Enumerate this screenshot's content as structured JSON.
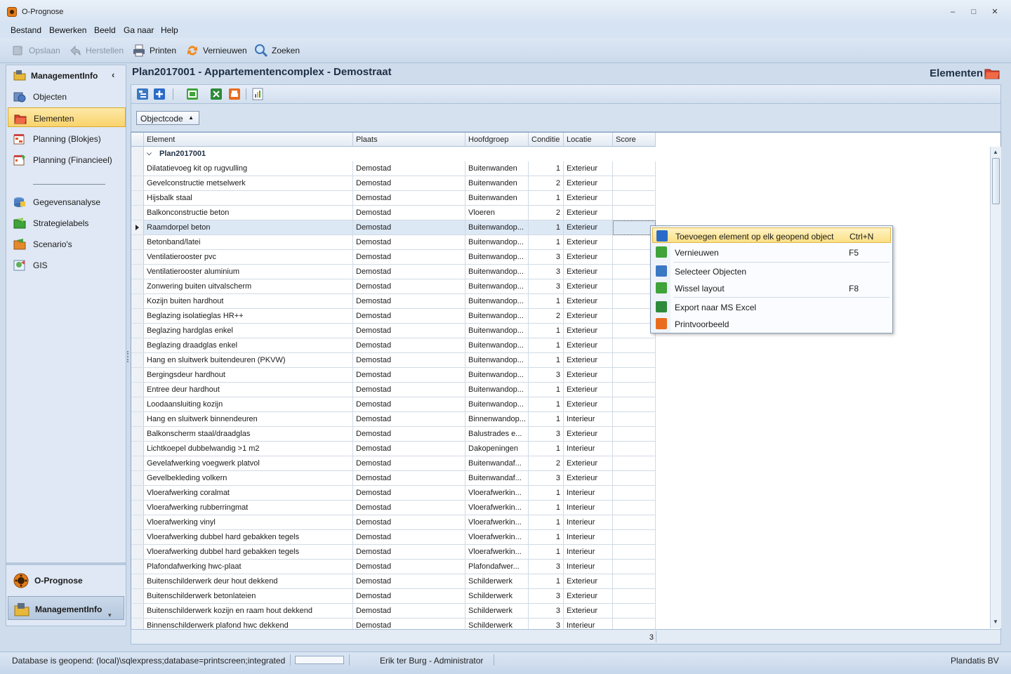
{
  "window": {
    "title": "O-Prognose",
    "minimize": "–",
    "maximize": "□",
    "close": "✕"
  },
  "menu": [
    "Bestand",
    "Bewerken",
    "Beeld",
    "Ga naar",
    "Help"
  ],
  "toolbar": {
    "save": "Opslaan",
    "restore": "Herstellen",
    "print": "Printen",
    "refresh": "Vernieuwen",
    "search": "Zoeken"
  },
  "nav": {
    "header": "ManagementInfo",
    "collapse": "‹",
    "items": [
      {
        "label": "Objecten",
        "icon": "objects-icon"
      },
      {
        "label": "Elementen",
        "icon": "elements-icon",
        "selected": true
      },
      {
        "label": "Planning (Blokjes)",
        "icon": "planning-blocks-icon"
      },
      {
        "label": "Planning (Financieel)",
        "icon": "planning-financial-icon"
      },
      {
        "label": "Gegevensanalyse",
        "icon": "data-analysis-icon"
      },
      {
        "label": "Strategielabels",
        "icon": "strategy-labels-icon"
      },
      {
        "label": "Scenario's",
        "icon": "scenarios-icon"
      },
      {
        "label": "GIS",
        "icon": "gis-icon"
      }
    ],
    "bottom": [
      {
        "label": "O-Prognose",
        "icon": "o-prognose-icon"
      },
      {
        "label": "ManagementInfo",
        "icon": "management-info-icon"
      }
    ],
    "more": "▾"
  },
  "panel": {
    "title": "Plan2017001 - Appartementencomplex - Demostraat",
    "module": "Elementen"
  },
  "groupbar": {
    "chip": "Objectcode",
    "arrow": "▲"
  },
  "grid": {
    "columns": [
      "Element",
      "Plaats",
      "Hoofdgroep",
      "Conditie",
      "Locatie",
      "Score"
    ],
    "group": "Plan2017001",
    "group_toggle": "⌵",
    "rows": [
      [
        "Dilatatievoeg kit op rugvulling",
        "Demostad",
        "Buitenwanden",
        "1",
        "Exterieur",
        ""
      ],
      [
        "Gevelconstructie metselwerk",
        "Demostad",
        "Buitenwanden",
        "2",
        "Exterieur",
        ""
      ],
      [
        "Hijsbalk staal",
        "Demostad",
        "Buitenwanden",
        "1",
        "Exterieur",
        ""
      ],
      [
        "Balkonconstructie beton",
        "Demostad",
        "Vloeren",
        "2",
        "Exterieur",
        ""
      ],
      [
        "Raamdorpel beton",
        "Demostad",
        "Buitenwandop...",
        "1",
        "Exterieur",
        ""
      ],
      [
        "Betonband/latei",
        "Demostad",
        "Buitenwandop...",
        "1",
        "Exterieur",
        ""
      ],
      [
        "Ventilatierooster pvc",
        "Demostad",
        "Buitenwandop...",
        "3",
        "Exterieur",
        ""
      ],
      [
        "Ventilatierooster aluminium",
        "Demostad",
        "Buitenwandop...",
        "3",
        "Exterieur",
        ""
      ],
      [
        "Zonwering buiten uitvalscherm",
        "Demostad",
        "Buitenwandop...",
        "3",
        "Exterieur",
        ""
      ],
      [
        "Kozijn buiten hardhout",
        "Demostad",
        "Buitenwandop...",
        "1",
        "Exterieur",
        ""
      ],
      [
        "Beglazing isolatieglas HR++",
        "Demostad",
        "Buitenwandop...",
        "2",
        "Exterieur",
        ""
      ],
      [
        "Beglazing hardglas enkel",
        "Demostad",
        "Buitenwandop...",
        "1",
        "Exterieur",
        ""
      ],
      [
        "Beglazing draadglas enkel",
        "Demostad",
        "Buitenwandop...",
        "1",
        "Exterieur",
        ""
      ],
      [
        "Hang en sluitwerk buitendeuren (PKVW)",
        "Demostad",
        "Buitenwandop...",
        "1",
        "Exterieur",
        ""
      ],
      [
        "Bergingsdeur hardhout",
        "Demostad",
        "Buitenwandop...",
        "3",
        "Exterieur",
        ""
      ],
      [
        "Entree deur hardhout",
        "Demostad",
        "Buitenwandop...",
        "1",
        "Exterieur",
        ""
      ],
      [
        "Loodaansluiting kozijn",
        "Demostad",
        "Buitenwandop...",
        "1",
        "Exterieur",
        ""
      ],
      [
        "Hang en sluitwerk binnendeuren",
        "Demostad",
        "Binnenwandop...",
        "1",
        "Interieur",
        ""
      ],
      [
        "Balkonscherm staal/draadglas",
        "Demostad",
        "Balustrades e...",
        "3",
        "Exterieur",
        ""
      ],
      [
        "Lichtkoepel dubbelwandig >1 m2",
        "Demostad",
        "Dakopeningen",
        "1",
        "Interieur",
        ""
      ],
      [
        "Gevelafwerking voegwerk platvol",
        "Demostad",
        "Buitenwandaf...",
        "2",
        "Exterieur",
        ""
      ],
      [
        "Gevelbekleding volkern",
        "Demostad",
        "Buitenwandaf...",
        "3",
        "Exterieur",
        ""
      ],
      [
        "Vloerafwerking coralmat",
        "Demostad",
        "Vloerafwerkin...",
        "1",
        "Interieur",
        ""
      ],
      [
        "Vloerafwerking rubberringmat",
        "Demostad",
        "Vloerafwerkin...",
        "1",
        "Interieur",
        ""
      ],
      [
        "Vloerafwerking vinyl",
        "Demostad",
        "Vloerafwerkin...",
        "1",
        "Interieur",
        ""
      ],
      [
        "Vloerafwerking dubbel hard gebakken tegels",
        "Demostad",
        "Vloerafwerkin...",
        "1",
        "Interieur",
        ""
      ],
      [
        "Vloerafwerking dubbel hard gebakken tegels",
        "Demostad",
        "Vloerafwerkin...",
        "1",
        "Interieur",
        ""
      ],
      [
        "Plafondafwerking hwc-plaat",
        "Demostad",
        "Plafondafwer...",
        "3",
        "Interieur",
        ""
      ],
      [
        "Buitenschilderwerk deur hout dekkend",
        "Demostad",
        "Schilderwerk",
        "1",
        "Exterieur",
        ""
      ],
      [
        "Buitenschilderwerk betonlateien",
        "Demostad",
        "Schilderwerk",
        "3",
        "Exterieur",
        ""
      ],
      [
        "Buitenschilderwerk kozijn en raam hout dekkend",
        "Demostad",
        "Schilderwerk",
        "3",
        "Exterieur",
        ""
      ],
      [
        "Binnenschilderwerk plafond hwc dekkend",
        "Demostad",
        "Schilderwerk",
        "3",
        "Interieur",
        ""
      ]
    ],
    "focused_row": 4,
    "footer_count": "3",
    "scroll_up": "▲",
    "scroll_down": "▼"
  },
  "context_menu": [
    {
      "label": "Toevoegen element op elk geopend object",
      "shortcut": "Ctrl+N",
      "icon": "add-icon",
      "color": "#2a6bc9",
      "highlighted": true
    },
    {
      "label": "Vernieuwen",
      "shortcut": "F5",
      "icon": "refresh-icon",
      "color": "#3fa33a"
    },
    {
      "label": "Selecteer Objecten",
      "shortcut": "",
      "icon": "select-objects-icon",
      "color": "#3b78c4"
    },
    {
      "label": "Wissel layout",
      "shortcut": "F8",
      "icon": "switch-layout-icon",
      "color": "#3fa33a"
    },
    {
      "label": "Export naar MS Excel",
      "shortcut": "",
      "icon": "excel-icon",
      "color": "#2d8a3a"
    },
    {
      "label": "Printvoorbeeld",
      "shortcut": "",
      "icon": "print-preview-icon",
      "color": "#e96c1e"
    }
  ],
  "statusbar": {
    "db": "Database is geopend: (local)\\sqlexpress;database=printscreen;integrated",
    "user": "Erik ter Burg - Administrator",
    "company": "Plandatis BV"
  }
}
